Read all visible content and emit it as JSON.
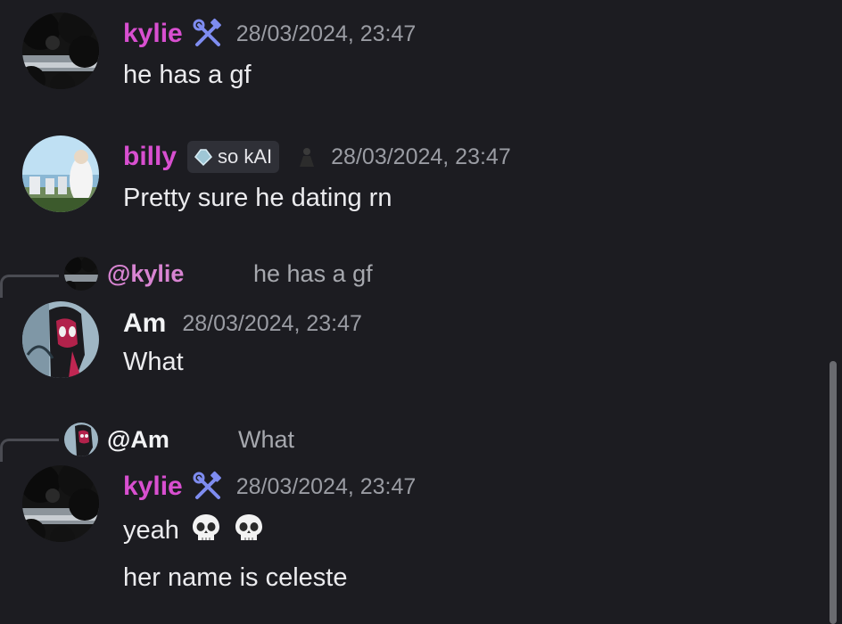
{
  "colors": {
    "background": "#1c1c21",
    "kylie": "#d84fd0",
    "billy": "#d84fd0",
    "am": "#f2f3f5",
    "reply_kylie": "#d884d2",
    "timestamp": "#9a9ca3",
    "tool_icon": "#7e8cf0"
  },
  "messages": [
    {
      "author": "kylie",
      "badge_icon": "hammer-wrench-icon",
      "timestamp": "28/03/2024, 23:47",
      "lines": [
        "he has a gf"
      ]
    },
    {
      "author": "billy",
      "tag": {
        "icon": "diamond-icon",
        "label": "so kAI"
      },
      "decor_icon": "figure-icon",
      "timestamp": "28/03/2024, 23:47",
      "lines": [
        "Pretty sure he dating rn"
      ]
    },
    {
      "reply": {
        "mention": "@kylie",
        "text": "he has a gf"
      },
      "author": "Am",
      "timestamp": "28/03/2024, 23:47",
      "lines": [
        "What"
      ]
    },
    {
      "reply": {
        "mention": "@Am",
        "text": "What"
      },
      "author": "kylie",
      "badge_icon": "hammer-wrench-icon",
      "timestamp": "28/03/2024, 23:47",
      "lines": [
        "yeah",
        "her name is celeste"
      ],
      "emoji": [
        "skull-emoji",
        "skull-emoji"
      ]
    }
  ]
}
